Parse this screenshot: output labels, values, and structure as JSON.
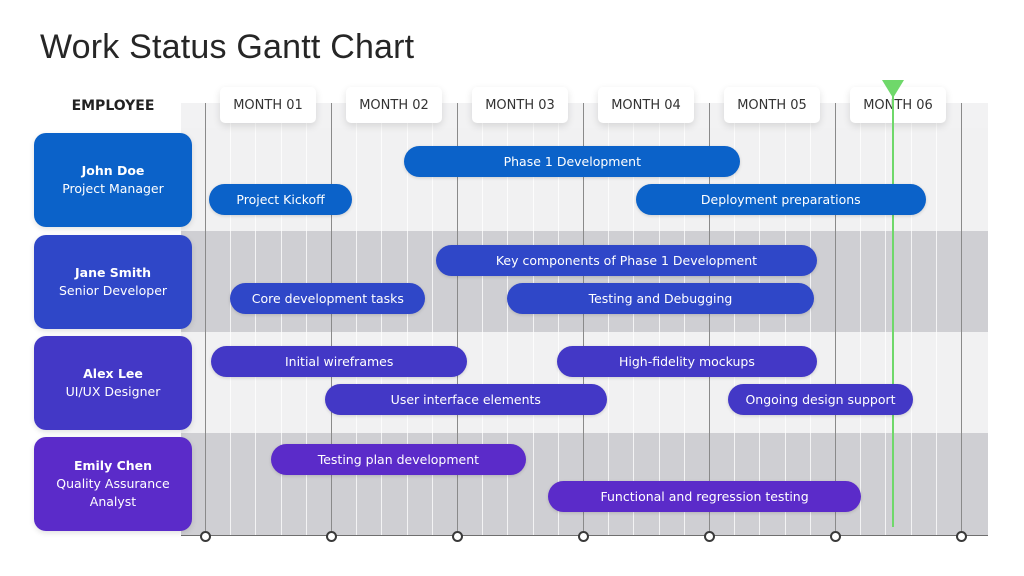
{
  "title": "Work Status Gantt Chart",
  "employee_header": "EMPLOYEE",
  "colors": {
    "john": "#0b62c9",
    "jane": "#2f47c8",
    "alex": "#4338c6",
    "emily": "#5b2bc9",
    "today_marker": "#6fd86a",
    "band_gray": "#cfcfd3",
    "band_light": "#f1f1f2"
  },
  "chart_data": {
    "type": "gantt",
    "title": "Work Status Gantt Chart",
    "x_unit": "month",
    "x_range": [
      0,
      6.2
    ],
    "x_ticks": [
      "MONTH 01",
      "MONTH 02",
      "MONTH 03",
      "MONTH 04",
      "MONTH 05",
      "MONTH 06"
    ],
    "today_marker": 5.46,
    "rows": [
      {
        "name": "John Doe",
        "role": "Project Manager",
        "color": "#0b62c9",
        "band": "light",
        "tasks": [
          {
            "label": "Phase 1 Development",
            "start": 1.58,
            "end": 4.25,
            "lane": 0
          },
          {
            "label": "Project Kickoff",
            "start": 0.03,
            "end": 1.17,
            "lane": 1
          },
          {
            "label": "Deployment preparations",
            "start": 3.42,
            "end": 5.72,
            "lane": 1
          }
        ]
      },
      {
        "name": "Jane Smith",
        "role": "Senior Developer",
        "color": "#2f47c8",
        "band": "gray",
        "tasks": [
          {
            "label": "Key components of Phase 1 Development",
            "start": 1.83,
            "end": 4.86,
            "lane": 0
          },
          {
            "label": "Core development tasks",
            "start": 0.2,
            "end": 1.75,
            "lane": 1
          },
          {
            "label": "Testing and Debugging",
            "start": 2.4,
            "end": 4.83,
            "lane": 1
          }
        ]
      },
      {
        "name": "Alex Lee",
        "role": "UI/UX Designer",
        "color": "#4338c6",
        "band": "light",
        "tasks": [
          {
            "label": "Initial wireframes",
            "start": 0.05,
            "end": 2.08,
            "lane": 0
          },
          {
            "label": "High-fidelity mockups",
            "start": 2.79,
            "end": 4.86,
            "lane": 0
          },
          {
            "label": "User interface elements",
            "start": 0.95,
            "end": 3.19,
            "lane": 1
          },
          {
            "label": "Ongoing design support",
            "start": 4.15,
            "end": 5.62,
            "lane": 1
          }
        ]
      },
      {
        "name": "Emily Chen",
        "role": "Quality Assurance Analyst",
        "color": "#5b2bc9",
        "band": "gray",
        "tasks": [
          {
            "label": "Testing plan development",
            "start": 0.52,
            "end": 2.55,
            "lane": 0
          },
          {
            "label": "Functional and regression testing",
            "start": 2.72,
            "end": 5.21,
            "lane": 1
          }
        ]
      }
    ]
  }
}
